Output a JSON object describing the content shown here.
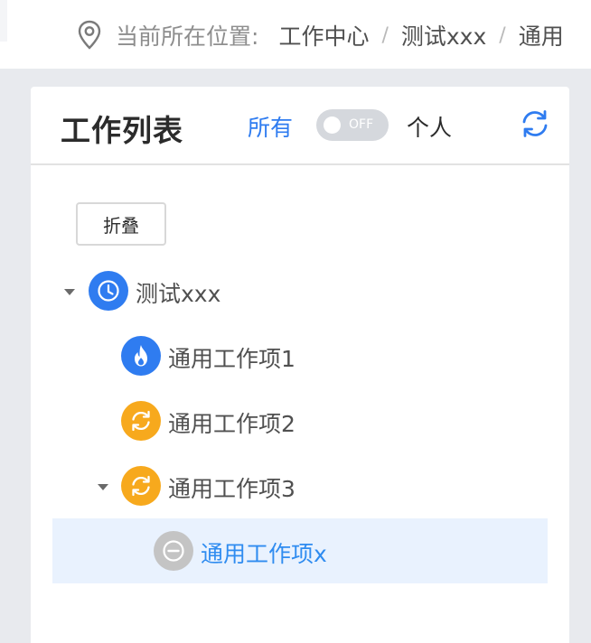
{
  "breadcrumb": {
    "label": "当前所在位置:",
    "separator": "/",
    "items": [
      "工作中心",
      "测试xxx",
      "通用"
    ]
  },
  "panel": {
    "title": "工作列表",
    "option_all": "所有",
    "toggle_text": "OFF",
    "option_personal": "个人",
    "collapse_label": "折叠"
  },
  "tree": [
    {
      "label": "测试xxx",
      "icon": "clock-icon",
      "color": "#2f7cf0",
      "expanded": true
    },
    {
      "label": "通用工作项1",
      "icon": "flame-icon",
      "color": "#2f7cf0"
    },
    {
      "label": "通用工作项2",
      "icon": "sync-icon",
      "color": "#f7a91d"
    },
    {
      "label": "通用工作项3",
      "icon": "sync-icon",
      "color": "#f7a91d",
      "expanded": true
    },
    {
      "label": "通用工作项x",
      "icon": "minus-circle-icon",
      "color": "#c4c4c4",
      "selected": true
    }
  ],
  "colors": {
    "accent": "#2f7cf0",
    "warning": "#f7a91d",
    "disabled": "#c4c4c4",
    "selected_bg": "#e9f2fe"
  }
}
